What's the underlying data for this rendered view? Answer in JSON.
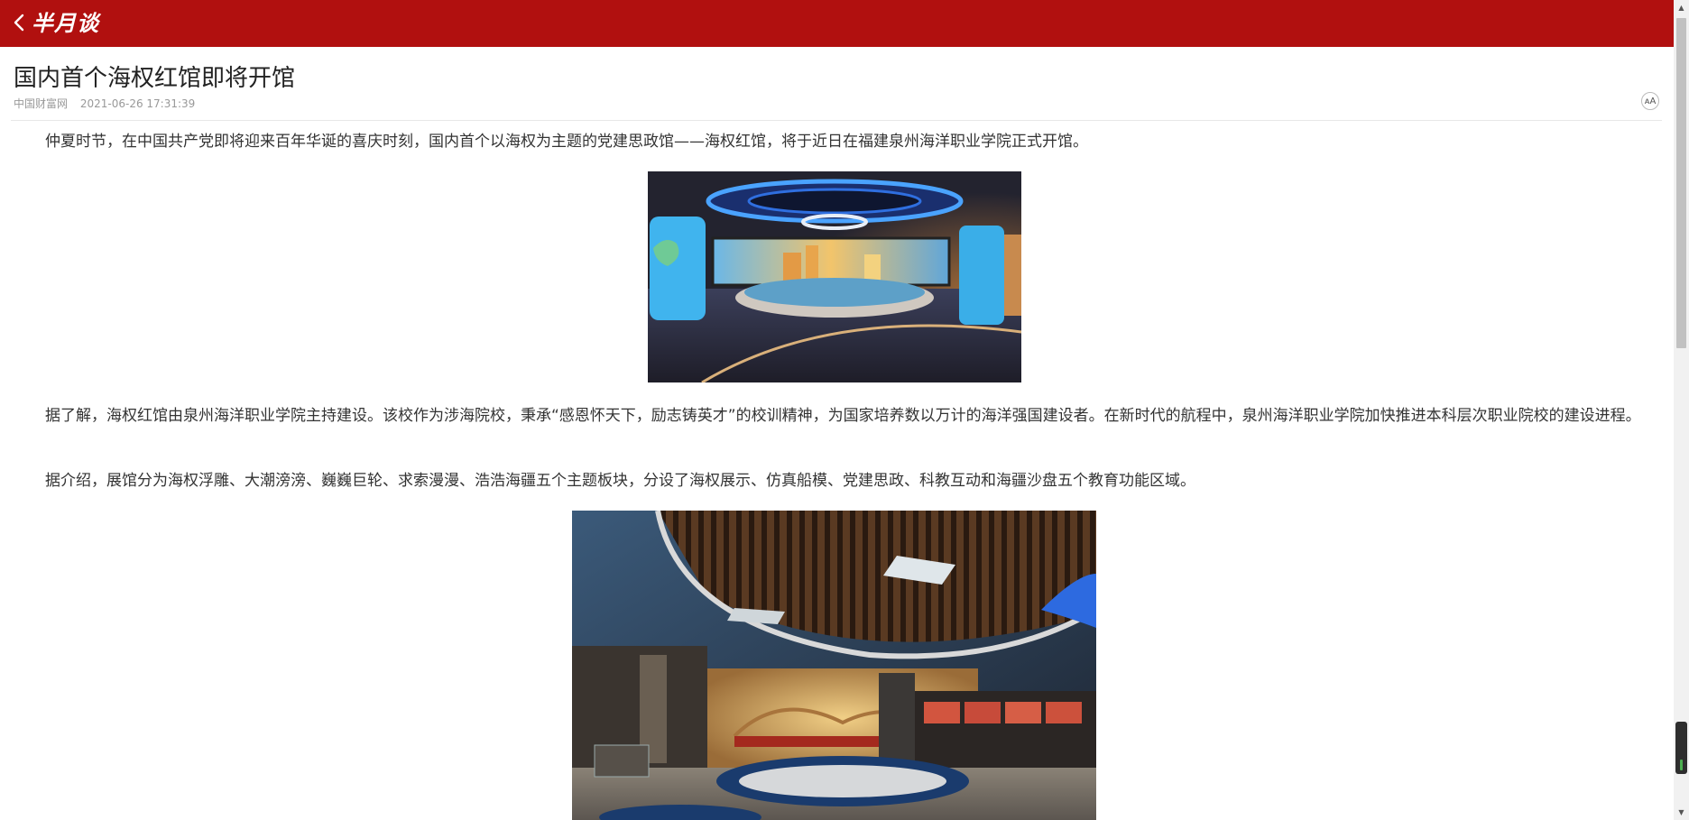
{
  "header": {
    "logo_text": "半月谈",
    "back_icon": "chevron-left-icon",
    "background_color": "#b1100f"
  },
  "article": {
    "title": "国内首个海权红馆即将开馆",
    "source": "中国财富网",
    "date": "2021-06-26 17:31:39",
    "font_size_button_label": "ᴀA",
    "paragraphs": [
      "仲夏时节，在中国共产党即将迎来百年华诞的喜庆时刻，国内首个以海权为主题的党建思政馆——海权红馆，将于近日在福建泉州海洋职业学院正式开馆。",
      "据了解，海权红馆由泉州海洋职业学院主持建设。该校作为涉海院校，秉承“感恩怀天下，励志铸英才”的校训精神，为国家培养数以万计的海洋强国建设者。在新时代的航程中，泉州海洋职业学院加快推进本科层次职业院校的建设进程。",
      "据介绍，展馆分为海权浮雕、大潮滂滂、巍巍巨轮、求索漫漫、浩浩海疆五个主题板块，分设了海权展示、仿真船模、党建思政、科教互动和海疆沙盘五个教育功能区域。"
    ],
    "images": [
      {
        "description": "exhibition hall interior with circular table and blue screens"
      },
      {
        "description": "exhibition hall with wooden ceiling and relief wall"
      }
    ]
  },
  "scrollbar": {
    "up_arrow": "▲",
    "down_arrow": "▼"
  }
}
